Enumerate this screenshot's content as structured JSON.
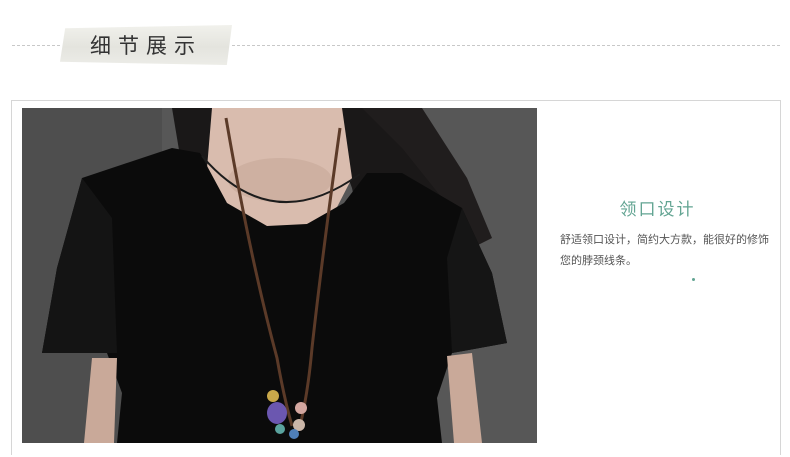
{
  "section": {
    "title": "细节展示"
  },
  "detail": {
    "title": "领口设计",
    "description": "舒适领口设计，简约大方款，能很好的修饰您的脖颈线条。"
  },
  "colors": {
    "accent": "#62a492",
    "background": "#ffffff",
    "photo_backdrop": "#555555",
    "garment": "#0a0a0a"
  },
  "icons": {
    "photo": "product-photo-necklace"
  }
}
